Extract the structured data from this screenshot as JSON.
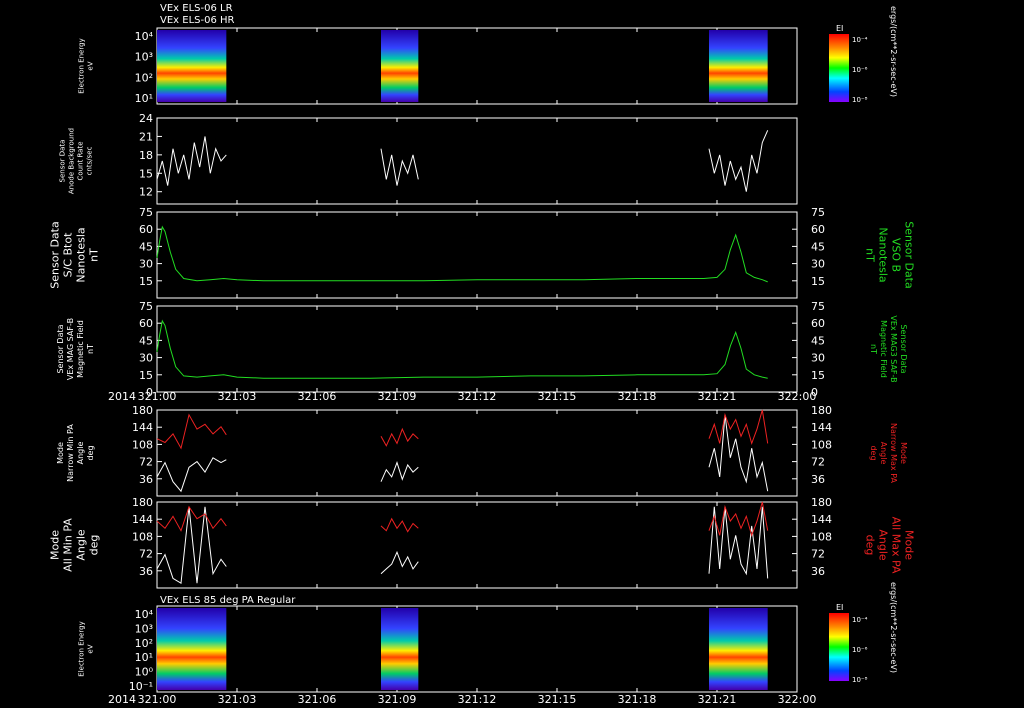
{
  "header": {
    "line1": "VEx ELS-06 LR",
    "line2": "VEx ELS-06 HR"
  },
  "footer_title": "VEx ELS 85 deg PA Regular",
  "year_label": "2014",
  "time_ticks": [
    "321:00",
    "321:03",
    "321:06",
    "321:09",
    "321:12",
    "321:15",
    "321:18",
    "321:21",
    "322:00"
  ],
  "colorbar": {
    "label": "EI",
    "units": "ergs/(cm**2-sr-sec-eV)",
    "ticks": [
      "10⁻⁴",
      "10⁻⁶",
      "10⁻⁸"
    ]
  },
  "colors": {
    "bg": "#000000",
    "white": "#ffffff",
    "green": "#22dd22",
    "red": "#ee2222"
  },
  "chart_data": [
    {
      "type": "heatmap",
      "name": "els-spectrogram-top",
      "ylabel_lines": [
        "Electron Energy",
        "eV"
      ],
      "yticks": [
        "10⁴",
        "10³",
        "10²",
        "10¹"
      ],
      "ylim": [
        3,
        20000
      ],
      "data_windows": [
        [
          "321:00",
          "321:02.6"
        ],
        [
          "321:08.4",
          "321:09.8"
        ],
        [
          "321:20.7",
          "321:22.9"
        ]
      ]
    },
    {
      "type": "line",
      "name": "background-count",
      "ylabel_lines": [
        "Sensor Data",
        "Anode Background",
        "Count Rate",
        "cnts/sec"
      ],
      "ylim": [
        10,
        24
      ],
      "yticks": [
        "24",
        "21",
        "18",
        "15",
        "12"
      ],
      "color": "#ffffff",
      "segments": [
        {
          "x": [
            0.0,
            0.2,
            0.4,
            0.6,
            0.8,
            1.0,
            1.2,
            1.4,
            1.6,
            1.8,
            2.0,
            2.2,
            2.4,
            2.6
          ],
          "y": [
            14,
            17,
            13,
            19,
            15,
            18,
            14,
            20,
            16,
            21,
            15,
            19,
            17,
            18
          ]
        },
        {
          "x": [
            8.4,
            8.6,
            8.8,
            9.0,
            9.2,
            9.4,
            9.6,
            9.8
          ],
          "y": [
            19,
            14,
            18,
            13,
            17,
            15,
            18,
            14
          ]
        },
        {
          "x": [
            20.7,
            20.9,
            21.1,
            21.3,
            21.5,
            21.7,
            21.9,
            22.1,
            22.3,
            22.5,
            22.7,
            22.9
          ],
          "y": [
            19,
            15,
            18,
            13,
            17,
            14,
            16,
            12,
            18,
            15,
            20,
            22
          ]
        }
      ]
    },
    {
      "type": "line",
      "name": "btot",
      "ylabel_lines": [
        "Sensor Data",
        "S/C Btot",
        "Nanotesla",
        "nT"
      ],
      "ylabel_right_lines": [
        "Sensor Data",
        "VSO B",
        "Nanotesla",
        "nT"
      ],
      "ylim": [
        0,
        75
      ],
      "yticks": [
        "75",
        "60",
        "45",
        "30",
        "15"
      ],
      "color": "#22dd22",
      "x": [
        0.0,
        0.1,
        0.2,
        0.3,
        0.5,
        0.7,
        1.0,
        1.5,
        2.0,
        2.5,
        3.0,
        4.0,
        6.0,
        8.0,
        10.0,
        12.0,
        14.0,
        16.0,
        18.0,
        19.5,
        20.5,
        21.0,
        21.3,
        21.5,
        21.7,
        21.9,
        22.1,
        22.4,
        22.7,
        22.9
      ],
      "y": [
        35,
        50,
        62,
        58,
        40,
        25,
        17,
        15,
        16,
        17,
        16,
        15,
        15,
        15,
        15,
        16,
        16,
        16,
        17,
        17,
        17,
        18,
        25,
        42,
        55,
        40,
        22,
        18,
        16,
        14
      ]
    },
    {
      "type": "line",
      "name": "mag-saf-b",
      "ylabel_lines": [
        "Sensor Data",
        "VEx MAG SAF-B",
        "Magnetic Field",
        "nT"
      ],
      "ylabel_right_lines": [
        "Sensor Data",
        "VEx MAG3 SAF-B",
        "Magnetic Field",
        "nT"
      ],
      "ylim": [
        0,
        75
      ],
      "yticks": [
        "75",
        "60",
        "45",
        "30",
        "15",
        "0"
      ],
      "color": "#22dd22",
      "x": [
        0.0,
        0.1,
        0.2,
        0.3,
        0.5,
        0.7,
        1.0,
        1.5,
        2.0,
        2.5,
        3.0,
        4.0,
        6.0,
        8.0,
        10.0,
        12.0,
        14.0,
        16.0,
        18.0,
        19.5,
        20.5,
        21.0,
        21.3,
        21.5,
        21.7,
        21.9,
        22.1,
        22.4,
        22.7,
        22.9
      ],
      "y": [
        35,
        50,
        62,
        58,
        38,
        22,
        14,
        13,
        14,
        15,
        13,
        12,
        12,
        12,
        13,
        13,
        14,
        14,
        15,
        15,
        15,
        16,
        24,
        40,
        52,
        38,
        20,
        15,
        13,
        12
      ]
    },
    {
      "type": "line",
      "name": "narrow-pa",
      "ylabel_lines": [
        "Mode",
        "Narrow Min PA",
        "Angle",
        "deg"
      ],
      "ylabel_right_lines": [
        "Mode",
        "Narrow Max PA",
        "Angle",
        "deg"
      ],
      "ylim": [
        0,
        180
      ],
      "yticks": [
        "180",
        "144",
        "108",
        "72",
        "36"
      ],
      "series": [
        {
          "name": "Min PA",
          "color": "#ffffff",
          "segments": [
            {
              "x": [
                0.0,
                0.3,
                0.6,
                0.9,
                1.2,
                1.5,
                1.8,
                2.1,
                2.4,
                2.6
              ],
              "y": [
                40,
                70,
                30,
                10,
                60,
                72,
                50,
                80,
                70,
                76
              ]
            },
            {
              "x": [
                8.4,
                8.6,
                8.8,
                9.0,
                9.2,
                9.4,
                9.6,
                9.8
              ],
              "y": [
                30,
                55,
                40,
                70,
                35,
                65,
                50,
                60
              ]
            },
            {
              "x": [
                20.7,
                20.9,
                21.1,
                21.3,
                21.5,
                21.7,
                21.9,
                22.1,
                22.3,
                22.5,
                22.7,
                22.9
              ],
              "y": [
                60,
                100,
                40,
                170,
                80,
                120,
                60,
                30,
                100,
                40,
                70,
                10
              ]
            }
          ]
        },
        {
          "name": "Max PA",
          "color": "#ee2222",
          "segments": [
            {
              "x": [
                0.0,
                0.3,
                0.6,
                0.9,
                1.2,
                1.5,
                1.8,
                2.1,
                2.4,
                2.6
              ],
              "y": [
                120,
                112,
                130,
                100,
                170,
                140,
                150,
                130,
                145,
                128
              ]
            },
            {
              "x": [
                8.4,
                8.6,
                8.8,
                9.0,
                9.2,
                9.4,
                9.6,
                9.8
              ],
              "y": [
                125,
                105,
                130,
                110,
                140,
                115,
                130,
                120
              ]
            },
            {
              "x": [
                20.7,
                20.9,
                21.1,
                21.3,
                21.5,
                21.7,
                21.9,
                22.1,
                22.3,
                22.5,
                22.7,
                22.9
              ],
              "y": [
                120,
                150,
                110,
                170,
                140,
                160,
                125,
                150,
                110,
                140,
                180,
                110
              ]
            }
          ]
        }
      ]
    },
    {
      "type": "line",
      "name": "all-pa",
      "ylabel_lines": [
        "Mode",
        "All Min PA",
        "Angle",
        "deg"
      ],
      "ylabel_right_lines": [
        "Mode",
        "All Max PA",
        "Angle",
        "deg"
      ],
      "ylim": [
        0,
        180
      ],
      "yticks": [
        "180",
        "144",
        "108",
        "72",
        "36"
      ],
      "series": [
        {
          "name": "Min PA",
          "color": "#ffffff",
          "segments": [
            {
              "x": [
                0.0,
                0.3,
                0.6,
                0.9,
                1.2,
                1.5,
                1.8,
                2.1,
                2.4,
                2.6
              ],
              "y": [
                40,
                70,
                20,
                10,
                170,
                10,
                170,
                30,
                60,
                45
              ]
            },
            {
              "x": [
                8.4,
                8.6,
                8.8,
                9.0,
                9.2,
                9.4,
                9.6,
                9.8
              ],
              "y": [
                30,
                40,
                50,
                75,
                45,
                65,
                40,
                55
              ]
            },
            {
              "x": [
                20.7,
                20.9,
                21.1,
                21.3,
                21.5,
                21.7,
                21.9,
                22.1,
                22.3,
                22.5,
                22.7,
                22.9
              ],
              "y": [
                30,
                170,
                40,
                170,
                60,
                110,
                50,
                30,
                130,
                40,
                170,
                20
              ]
            }
          ]
        },
        {
          "name": "Max PA",
          "color": "#ee2222",
          "segments": [
            {
              "x": [
                0.0,
                0.3,
                0.6,
                0.9,
                1.2,
                1.5,
                1.8,
                2.1,
                2.4,
                2.6
              ],
              "y": [
                140,
                125,
                150,
                120,
                170,
                145,
                155,
                125,
                145,
                130
              ]
            },
            {
              "x": [
                8.4,
                8.6,
                8.8,
                9.0,
                9.2,
                9.4,
                9.6,
                9.8
              ],
              "y": [
                130,
                120,
                145,
                125,
                140,
                118,
                135,
                125
              ]
            },
            {
              "x": [
                20.7,
                20.9,
                21.1,
                21.3,
                21.5,
                21.7,
                21.9,
                22.1,
                22.3,
                22.5,
                22.7,
                22.9
              ],
              "y": [
                120,
                150,
                110,
                170,
                140,
                155,
                125,
                150,
                110,
                140,
                180,
                120
              ]
            }
          ]
        }
      ]
    },
    {
      "type": "heatmap",
      "name": "els-spectrogram-bottom",
      "ylabel_lines": [
        "Electron Energy",
        "eV"
      ],
      "yticks": [
        "10⁴",
        "10³",
        "10²",
        "10¹",
        "10⁰",
        "10⁻¹"
      ],
      "ylim": [
        0.1,
        20000
      ],
      "data_windows": [
        [
          "321:00",
          "321:02.6"
        ],
        [
          "321:08.4",
          "321:09.8"
        ],
        [
          "321:20.7",
          "321:22.9"
        ]
      ]
    }
  ]
}
